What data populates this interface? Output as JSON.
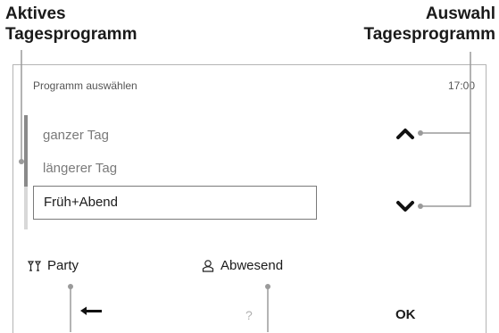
{
  "callouts": {
    "left": {
      "line1": "Aktives",
      "line2": "Tagesprogramm"
    },
    "right": {
      "line1": "Auswahl",
      "line2": "Tagesprogramm"
    }
  },
  "screen": {
    "title": "Programm auswählen",
    "time": "17:00",
    "list": {
      "items": [
        "ganzer Tag",
        "längerer Tag"
      ],
      "selected": "Früh+Abend"
    },
    "arrows": {
      "up": "chevron-up-icon",
      "down": "chevron-down-icon"
    },
    "softkeys": {
      "party": {
        "label": "Party",
        "icon": "cocktail-glasses-icon"
      },
      "abwesend": {
        "label": "Abwesend",
        "icon": "away-person-icon"
      },
      "back": {
        "icon": "back-arrow-icon"
      },
      "help": {
        "label": "?"
      },
      "ok": {
        "label": "OK"
      }
    }
  },
  "colors": {
    "callout_text": "#1a1a1a",
    "leader_line": "#9a9a9a",
    "muted_text": "#7a7a7a"
  }
}
